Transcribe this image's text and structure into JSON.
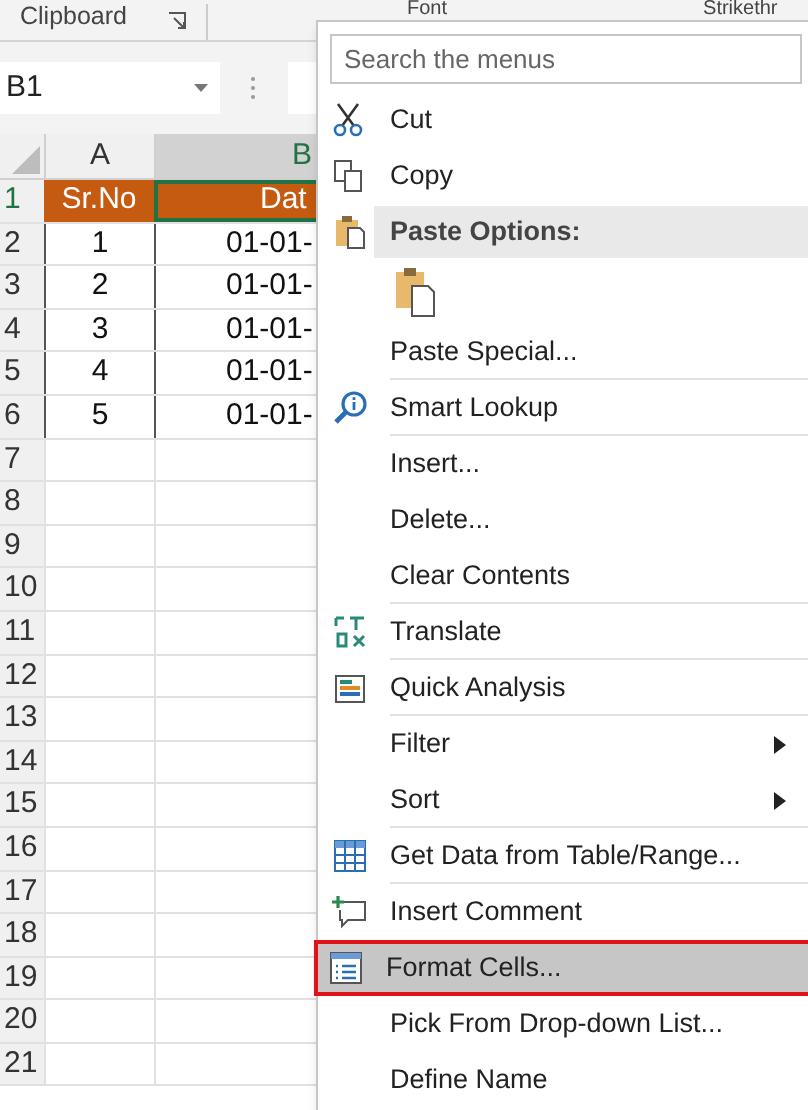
{
  "ribbon": {
    "groups": [
      {
        "label": "Clipboard"
      },
      {
        "label": "Font"
      },
      {
        "label": "Strikethr"
      }
    ]
  },
  "name_box": {
    "value": "B1"
  },
  "columns": [
    {
      "label": "A",
      "selected": false
    },
    {
      "label": "B",
      "selected": true
    }
  ],
  "rows": [
    {
      "label": "1",
      "cells": [
        "Sr.No",
        "Dat"
      ],
      "kind": "header"
    },
    {
      "label": "2",
      "cells": [
        "1",
        "01-01-"
      ],
      "kind": "data"
    },
    {
      "label": "3",
      "cells": [
        "2",
        "01-01-"
      ],
      "kind": "data"
    },
    {
      "label": "4",
      "cells": [
        "3",
        "01-01-"
      ],
      "kind": "data"
    },
    {
      "label": "5",
      "cells": [
        "4",
        "01-01-"
      ],
      "kind": "data"
    },
    {
      "label": "6",
      "cells": [
        "5",
        "01-01-"
      ],
      "kind": "data"
    },
    {
      "label": "7",
      "cells": [],
      "kind": "empty"
    },
    {
      "label": "8",
      "cells": [],
      "kind": "empty"
    },
    {
      "label": "9",
      "cells": [],
      "kind": "empty"
    },
    {
      "label": "10",
      "cells": [],
      "kind": "empty"
    },
    {
      "label": "11",
      "cells": [],
      "kind": "empty"
    },
    {
      "label": "12",
      "cells": [],
      "kind": "empty"
    },
    {
      "label": "13",
      "cells": [],
      "kind": "empty"
    },
    {
      "label": "14",
      "cells": [],
      "kind": "empty"
    },
    {
      "label": "15",
      "cells": [],
      "kind": "empty"
    },
    {
      "label": "16",
      "cells": [],
      "kind": "empty"
    },
    {
      "label": "17",
      "cells": [],
      "kind": "empty"
    },
    {
      "label": "18",
      "cells": [],
      "kind": "empty"
    },
    {
      "label": "19",
      "cells": [],
      "kind": "empty"
    },
    {
      "label": "20",
      "cells": [],
      "kind": "empty"
    },
    {
      "label": "21",
      "cells": [],
      "kind": "empty"
    }
  ],
  "context_menu": {
    "search": {
      "placeholder": "Search the menus"
    },
    "items": [
      {
        "kind": "item",
        "label": "Cut",
        "submenu": false,
        "selected": false,
        "separator_after": false
      },
      {
        "kind": "item",
        "label": "Copy",
        "submenu": false,
        "selected": false,
        "separator_after": false
      },
      {
        "kind": "header",
        "label": "Paste Options:"
      },
      {
        "kind": "paste_icons"
      },
      {
        "kind": "item",
        "label": "Paste Special...",
        "submenu": false,
        "selected": false,
        "separator_after": true
      },
      {
        "kind": "item",
        "label": "Smart Lookup",
        "submenu": false,
        "selected": false,
        "separator_after": true
      },
      {
        "kind": "item",
        "label": "Insert...",
        "submenu": false,
        "selected": false,
        "separator_after": false
      },
      {
        "kind": "item",
        "label": "Delete...",
        "submenu": false,
        "selected": false,
        "separator_after": false
      },
      {
        "kind": "item",
        "label": "Clear Contents",
        "submenu": false,
        "selected": false,
        "separator_after": true
      },
      {
        "kind": "item",
        "label": "Translate",
        "submenu": false,
        "selected": false,
        "separator_after": true
      },
      {
        "kind": "item",
        "label": "Quick Analysis",
        "submenu": false,
        "selected": false,
        "separator_after": true
      },
      {
        "kind": "item",
        "label": "Filter",
        "submenu": true,
        "selected": false,
        "separator_after": false
      },
      {
        "kind": "item",
        "label": "Sort",
        "submenu": true,
        "selected": false,
        "separator_after": true
      },
      {
        "kind": "item",
        "label": "Get Data from Table/Range...",
        "submenu": false,
        "selected": false,
        "separator_after": true
      },
      {
        "kind": "item",
        "label": "Insert Comment",
        "submenu": false,
        "selected": false,
        "separator_after": false
      },
      {
        "kind": "item",
        "label": "Format Cells...",
        "submenu": false,
        "selected": true,
        "separator_after": false
      },
      {
        "kind": "item",
        "label": "Pick From Drop-down List...",
        "submenu": false,
        "selected": false,
        "separator_after": false
      },
      {
        "kind": "item",
        "label": "Define Name",
        "submenu": false,
        "selected": false,
        "separator_after": false
      }
    ]
  }
}
